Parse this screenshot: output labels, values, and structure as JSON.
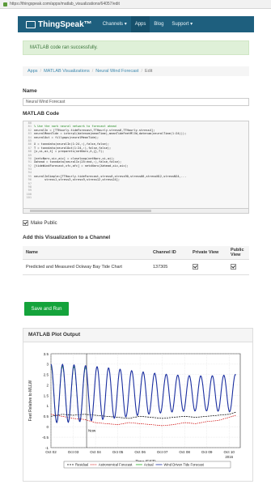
{
  "browser": {
    "url": "https://thingspeak.com/apps/matlab_visualizations/64057/edit"
  },
  "nav": {
    "logo": "ThingSpeak™",
    "links": [
      {
        "label": "Channels ▾",
        "active": false
      },
      {
        "label": "Apps",
        "active": true
      },
      {
        "label": "Blog",
        "active": false
      },
      {
        "label": "Support ▾",
        "active": false
      }
    ]
  },
  "alert": {
    "message": "MATLAB code ran successfully."
  },
  "breadcrumb": {
    "apps": "Apps",
    "visualizations": "MATLAB Visualizations",
    "item": "Neural Wind Forecast",
    "current": "Edit"
  },
  "name_section": {
    "label": "Name",
    "value": "Neural Wind Forecast"
  },
  "code_section": {
    "label": "MATLAB Code",
    "lines": [
      {
        "n": "80",
        "text": ""
      },
      {
        "n": "81",
        "text": "% Use the nark neural network to forecast ahead",
        "comment": true
      },
      {
        "n": "82",
        "text": "neuralIn = [TTHourly.tideForecast,TTHourly.stress6,TTHourly.stress4];"
      },
      {
        "n": "83",
        "text": "neuralMeanTide = interp1(datenum(meanTime),meanTideFeetMllW,datenum(neuralTime(1:24)));"
      },
      {
        "n": "84",
        "text": "neuralOut = fillgaps(neuralMeanTide);"
      },
      {
        "n": "85",
        "text": ""
      },
      {
        "n": "86",
        "text": "X = tonndata(neuralIn(1:24,:),false,false);"
      },
      {
        "n": "87",
        "text": "T = tonndata(neuralOut(1:24,:),false,false);"
      },
      {
        "n": "88",
        "text": "[x,xi,ai,t] = preparets(netNarx,X,{},T);"
      },
      {
        "n": "89",
        "text": ""
      },
      {
        "n": "90",
        "text": "[netcNarx,xic,aic] = closeloop(netNarx,xi,ai);"
      },
      {
        "n": "91",
        "text": "Xahead = tonndata(neuralIn(25:end,:),false,false);"
      },
      {
        "n": "92",
        "text": "[tideWindForecast,xfc,afc] = netcNarx(Xahead,xic,aic);"
      },
      {
        "n": "93",
        "text": ""
      },
      {
        "n": "94",
        "text": ""
      },
      {
        "n": "95",
        "text": "neuralInSimple=[TTHourly.tideForecast,stress6,stress90,stress66,stressN12,stressN24,..."
      },
      {
        "n": "96",
        "text": "      stress1,stress3,stress9,stress12,stress24];"
      },
      {
        "n": "97",
        "text": ""
      },
      {
        "n": "98",
        "text": ""
      },
      {
        "n": "99",
        "text": ""
      },
      {
        "n": "100",
        "text": ""
      },
      {
        "n": "101",
        "text": ""
      }
    ]
  },
  "make_public": {
    "label": "Make Public"
  },
  "channel_section": {
    "label": "Add this Visualization to a Channel",
    "headers": {
      "name": "Name",
      "id": "Channel ID",
      "private": "Private View",
      "public": "Public View"
    },
    "rows": [
      {
        "name": "Predicted and Measured Ockway Bay Tide Chart",
        "id": "137305"
      }
    ]
  },
  "save_button": {
    "label": "Save and Run"
  },
  "plot_panel": {
    "title": "MATLAB Plot Output"
  },
  "chart_data": {
    "type": "line",
    "xlabel": "Time (EST)",
    "ylabel": "Feet Relative to MLLW",
    "ylim": [
      -1,
      3.5
    ],
    "yticks": [
      "-1",
      "-0.5",
      "0",
      "0.5",
      "1",
      "1.5",
      "2",
      "2.5",
      "3",
      "3.5"
    ],
    "xticks": [
      "Oct 02",
      "Oct 03",
      "Oct 04",
      "Oct 05",
      "Oct 06",
      "Oct 07",
      "Oct 08",
      "Oct 09",
      "Oct 10"
    ],
    "xtick_year": "2016",
    "xlim": [
      0,
      8.5
    ],
    "annotation": "Now",
    "annotation_x": 1.6,
    "grid": true,
    "legend_position": "bottom",
    "colors": {
      "measured": "#000000",
      "astro": "#cc0000",
      "actual": "#22aa22",
      "wind": "#1a2ea0"
    },
    "series": [
      {
        "name": "Residual",
        "key": "residual",
        "color": "#000000",
        "x": [
          0,
          0.5,
          1,
          1.5,
          2,
          2.5,
          3,
          3.5,
          4,
          4.5,
          5,
          5.5,
          6,
          6.5,
          7,
          7.5,
          8,
          8.3
        ],
        "y": [
          0.5,
          0.6,
          0.55,
          0.6,
          0.55,
          0.5,
          0.45,
          0.4,
          0.5,
          0.45,
          0.4,
          0.45,
          0.5,
          0.45,
          0.5,
          0.55,
          0.6,
          0.7
        ]
      },
      {
        "name": "Astronomical Forecast",
        "key": "astro",
        "color": "#cc0000",
        "x": [
          0,
          0.5,
          1,
          1.5,
          2,
          2.5,
          3,
          3.5,
          4,
          4.5,
          5,
          5.5,
          6,
          6.5,
          7,
          7.5,
          8,
          8.3
        ],
        "y": [
          0.6,
          0.5,
          0.4,
          0.35,
          0.2,
          0.15,
          0.1,
          0.2,
          0.15,
          0.1,
          0.05,
          0.1,
          0.2,
          0.15,
          0.25,
          0.3,
          0.45,
          0.55
        ]
      },
      {
        "name": "Actual",
        "key": "actual",
        "color": "#22aa22",
        "amp": 1.35,
        "mid": 1.55,
        "x0": 0,
        "x1": 1.6
      },
      {
        "name": "Wind Driven Tide Forecast",
        "key": "wind",
        "color": "#1a2ea0",
        "amp": 1.4,
        "mid": 1.6,
        "x0": 0,
        "x1": 8.3
      }
    ]
  }
}
